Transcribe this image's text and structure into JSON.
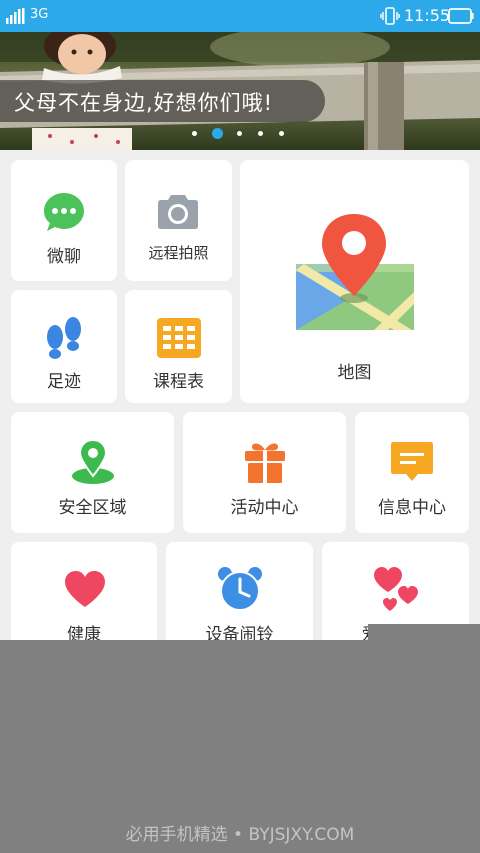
{
  "status_bar": {
    "network": "3G",
    "time": "11:55",
    "icons": [
      "signal-icon",
      "vibrate-icon",
      "battery-icon"
    ]
  },
  "banner": {
    "caption": "父母不在身边,好想你们哦!",
    "dot_count": 5,
    "active_dot": 1
  },
  "tiles": [
    {
      "id": "weiliao",
      "label": "微聊",
      "icon": "chat-icon",
      "color": "#4cc35a"
    },
    {
      "id": "remote_photo",
      "label": "远程拍照",
      "icon": "camera-icon",
      "color": "#9aa3ab"
    },
    {
      "id": "map",
      "label": "地图",
      "icon": "map-icon",
      "color": "#f0553f"
    },
    {
      "id": "footprint",
      "label": "足迹",
      "icon": "footprints-icon",
      "color": "#3b86e0"
    },
    {
      "id": "schedule",
      "label": "课程表",
      "icon": "grid-icon",
      "color": "#f6a823"
    },
    {
      "id": "safe_zone",
      "label": "安全区域",
      "icon": "location-pin-icon",
      "color": "#3dba4e"
    },
    {
      "id": "activity",
      "label": "活动中心",
      "icon": "gift-icon",
      "color": "#f2742f"
    },
    {
      "id": "info",
      "label": "信息中心",
      "icon": "message-icon",
      "color": "#f6a823"
    },
    {
      "id": "health",
      "label": "健康",
      "icon": "heart-icon",
      "color": "#ef4662"
    },
    {
      "id": "alarm",
      "label": "设备闹铃",
      "icon": "alarm-clock-icon",
      "color": "#3c8fe4"
    },
    {
      "id": "love",
      "label": "爱心奖励",
      "icon": "hearts-icon",
      "color": "#ef4662"
    }
  ],
  "watermark": "必用手机精选 • BYJSJXY.COM"
}
